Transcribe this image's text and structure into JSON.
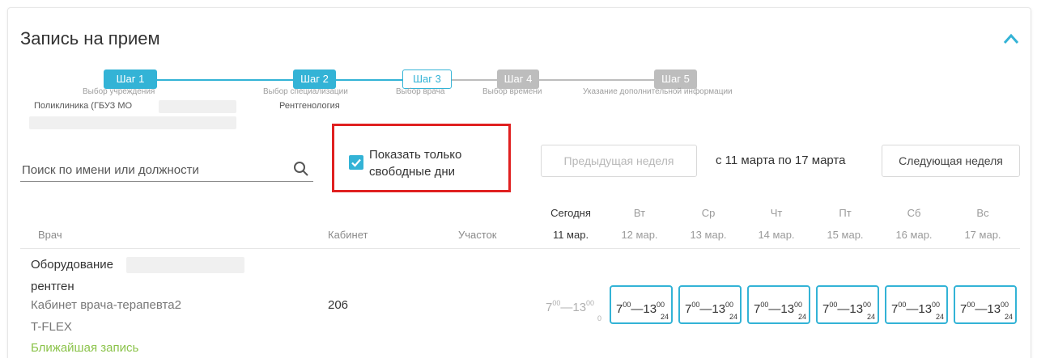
{
  "page": {
    "title": "Запись на прием"
  },
  "steps": [
    {
      "label": "Шаг 1",
      "desc": "Выбор учреждения",
      "value": "Поликлиника (ГБУЗ МО",
      "state": "done"
    },
    {
      "label": "Шаг 2",
      "desc": "Выбор специализации",
      "value": "Рентгенология",
      "state": "done"
    },
    {
      "label": "Шаг 3",
      "desc": "Выбор врача",
      "value": "",
      "state": "current"
    },
    {
      "label": "Шаг 4",
      "desc": "Выбор времени",
      "value": "",
      "state": "todo"
    },
    {
      "label": "Шаг 5",
      "desc": "Указание дополнительной информации",
      "value": "",
      "state": "todo"
    }
  ],
  "search": {
    "placeholder": "Поиск по имени или должности",
    "value": ""
  },
  "filter": {
    "checked": true,
    "label_line1": "Показать только",
    "label_line2": "свободные дни"
  },
  "week_nav": {
    "prev_label": "Предыдущая неделя",
    "range": "с 11 марта по 17 марта",
    "next_label": "Следующая неделя"
  },
  "table": {
    "col_doctor": "Врач",
    "col_cabinet": "Кабинет",
    "col_area": "Участок",
    "days": [
      {
        "name": "Сегодня",
        "date": "11 мар."
      },
      {
        "name": "Вт",
        "date": "12 мар."
      },
      {
        "name": "Ср",
        "date": "13 мар."
      },
      {
        "name": "Чт",
        "date": "14 мар."
      },
      {
        "name": "Пт",
        "date": "15 мар."
      },
      {
        "name": "Сб",
        "date": "16 мар."
      },
      {
        "name": "Вс",
        "date": "17 мар."
      }
    ]
  },
  "row": {
    "name_line1": "Оборудование",
    "name_line2": "рентген",
    "room_desc": "Кабинет врача-терапевта2",
    "system": "T-FLEX",
    "nearest_link": "Ближайшая запись",
    "cabinet": "206",
    "slots": [
      {
        "start_h": "7",
        "start_m": "00",
        "end_h": "13",
        "end_m": "00",
        "count": "0",
        "available": false
      },
      {
        "start_h": "7",
        "start_m": "00",
        "end_h": "13",
        "end_m": "00",
        "count": "24",
        "available": true
      },
      {
        "start_h": "7",
        "start_m": "00",
        "end_h": "13",
        "end_m": "00",
        "count": "24",
        "available": true
      },
      {
        "start_h": "7",
        "start_m": "00",
        "end_h": "13",
        "end_m": "00",
        "count": "24",
        "available": true
      },
      {
        "start_h": "7",
        "start_m": "00",
        "end_h": "13",
        "end_m": "00",
        "count": "24",
        "available": true
      },
      {
        "start_h": "7",
        "start_m": "00",
        "end_h": "13",
        "end_m": "00",
        "count": "24",
        "available": true
      },
      {
        "start_h": "7",
        "start_m": "00",
        "end_h": "13",
        "end_m": "00",
        "count": "24",
        "available": true
      }
    ]
  },
  "colors": {
    "accent": "#33b3d6",
    "inactive": "#bdbdbd",
    "link": "#8bc34a",
    "highlight": "#e02020"
  }
}
